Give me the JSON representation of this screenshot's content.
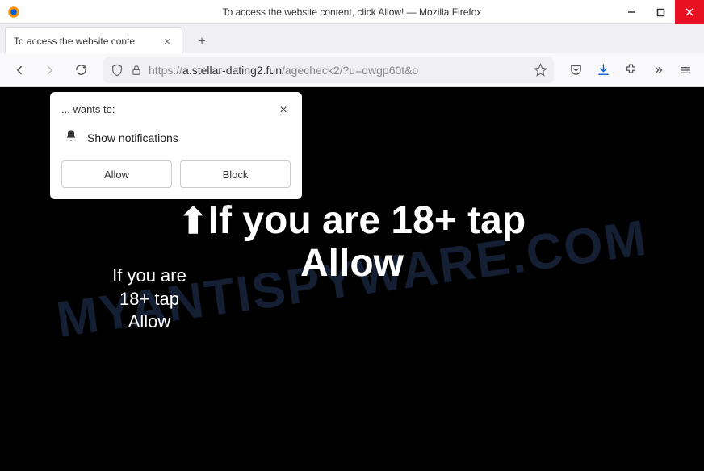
{
  "window": {
    "title": "To access the website content, click Allow! — Mozilla Firefox"
  },
  "tabs": [
    {
      "title": "To access the website conte"
    }
  ],
  "url": {
    "prefix": "https://",
    "domain": "a.stellar-dating2.fun",
    "path": "/agecheck2/?u=qwgp60t&o"
  },
  "notification": {
    "wants": "... wants to:",
    "text": "Show notifications",
    "allow": "Allow",
    "block": "Block"
  },
  "page": {
    "main_line1": "If you are 18+ tap",
    "main_line2": "Allow",
    "sub": "If you are 18+ tap Allow"
  },
  "watermark": "MYANTISPYWARE.COM"
}
